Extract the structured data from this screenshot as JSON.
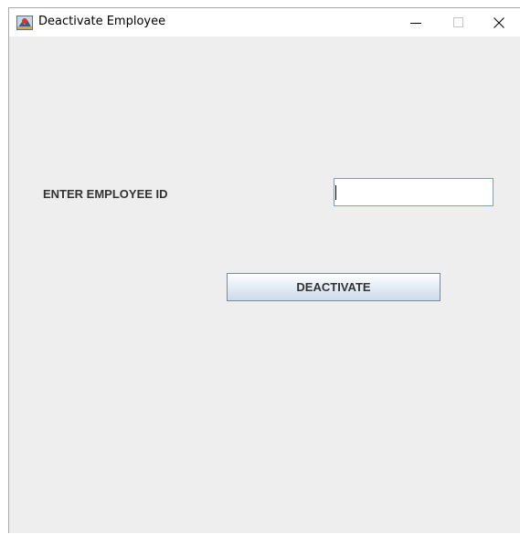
{
  "window": {
    "title": "Deactivate Employee",
    "icon": "java-app-icon",
    "controls": [
      "minimize-icon",
      "maximize-icon",
      "close-icon"
    ]
  },
  "form": {
    "employee_id_label": "ENTER EMPLOYEE ID",
    "employee_id_value": "",
    "deactivate_label": "DEACTIVATE"
  },
  "colors": {
    "content_background": "#eeeeee",
    "titlebar_background": "#ffffff",
    "input_border": "#7a9cc6",
    "label_text": "#333333"
  }
}
